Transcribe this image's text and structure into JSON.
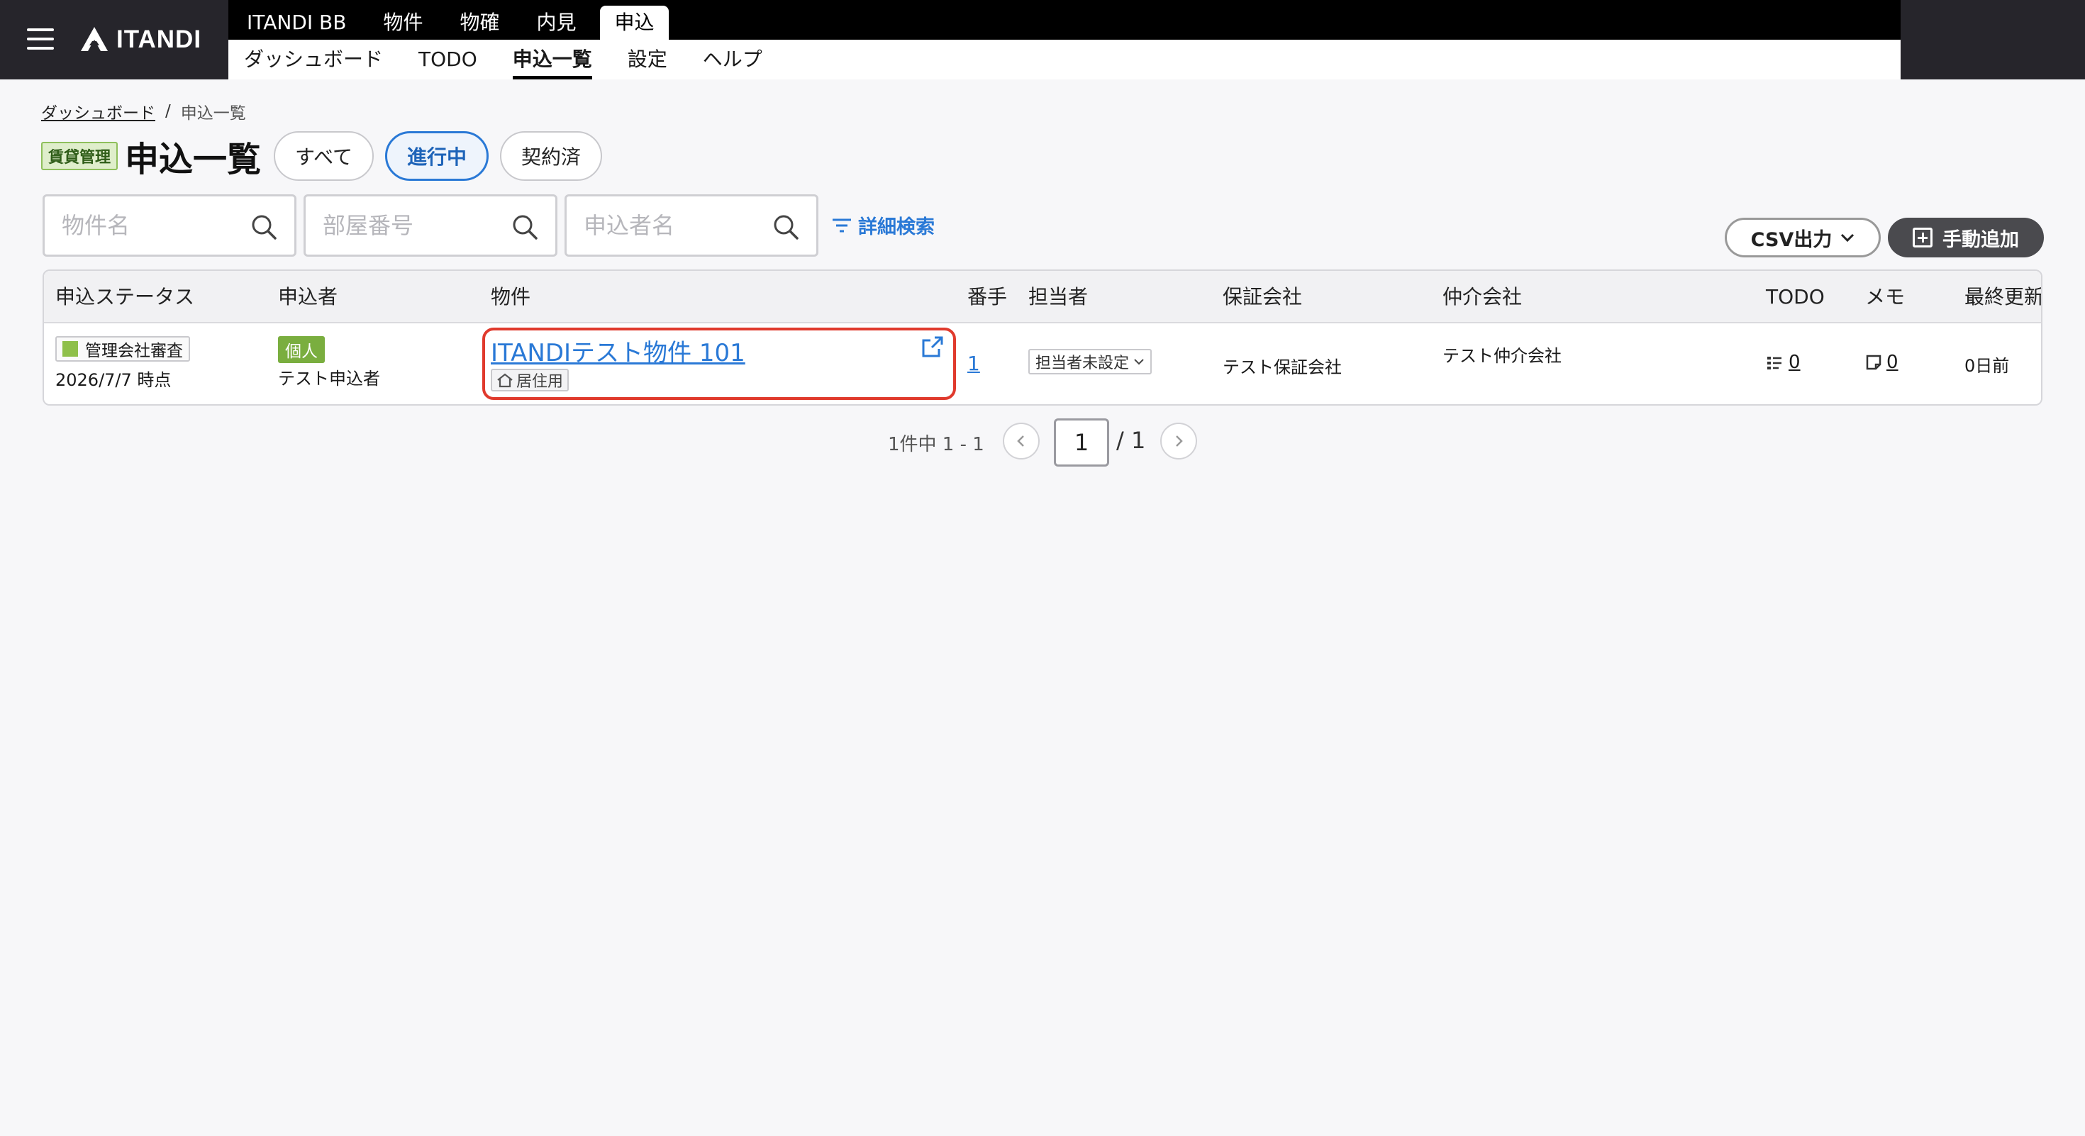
{
  "header": {
    "logo_text": "ITANDI",
    "top_tabs": [
      {
        "label": "ITANDI BB"
      },
      {
        "label": "物件"
      },
      {
        "label": "物確"
      },
      {
        "label": "内見"
      },
      {
        "label": "申込"
      }
    ],
    "sub_tabs": [
      {
        "label": "ダッシュボード"
      },
      {
        "label": "TODO"
      },
      {
        "label": "申込一覧"
      },
      {
        "label": "設定"
      },
      {
        "label": "ヘルプ"
      }
    ]
  },
  "breadcrumb": {
    "home": "ダッシュボード",
    "separator": "/",
    "current": "申込一覧"
  },
  "title": {
    "badge": "賃貸管理",
    "text": "申込一覧",
    "filters": [
      {
        "label": "すべて"
      },
      {
        "label": "進行中"
      },
      {
        "label": "契約済"
      }
    ]
  },
  "search": {
    "property_placeholder": "物件名",
    "room_placeholder": "部屋番号",
    "applicant_placeholder": "申込者名",
    "advanced_label": "詳細検索"
  },
  "actions": {
    "csv_label": "CSV出力",
    "add_label": "手動追加"
  },
  "table": {
    "headers": [
      "申込ステータス",
      "申込者",
      "物件",
      "番手",
      "担当者",
      "保証会社",
      "仲介会社",
      "TODO",
      "メモ",
      "最終更新"
    ],
    "rows": [
      {
        "status": "管理会社審査",
        "status_date": "2026/7/7 時点",
        "applicant_type": "個人",
        "applicant_name": "テスト申込者",
        "property": "ITANDIテスト物件 101",
        "property_tag": "居住用",
        "rank": "1",
        "assignee": "担当者未設定",
        "guarantor": "テスト保証会社",
        "broker": "テスト仲介会社",
        "todo_count": "0",
        "memo_count": "0",
        "updated": "0日前"
      }
    ]
  },
  "pagination": {
    "info": "1件中 1 - 1",
    "current_page": "1",
    "total": "/ 1"
  },
  "colors": {
    "accent": "#2a79d6",
    "header_bg": "#26252b",
    "highlight": "#e03a2d",
    "status_green": "#8fc04a"
  }
}
